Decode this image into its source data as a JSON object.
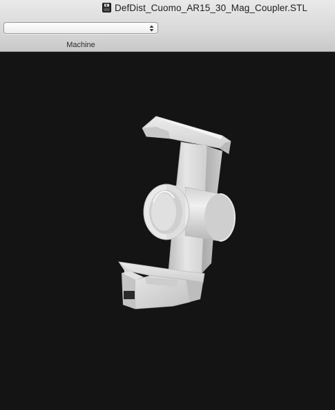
{
  "window": {
    "title": "DefDist_Cuomo_AR15_30_Mag_Coupler.STL",
    "title_icon": "stl-document-icon"
  },
  "toolbar": {
    "machine_select": {
      "value": "",
      "icon": "select-arrows-icon"
    },
    "machine_label": "Machine"
  },
  "viewport": {
    "background": "#141414",
    "model_color": "#d8d8d8"
  }
}
